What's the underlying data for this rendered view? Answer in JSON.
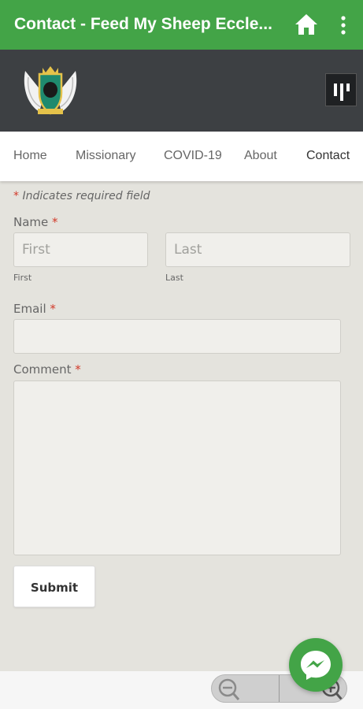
{
  "appbar": {
    "title": "Contact - Feed My Sheep Eccle...",
    "home_icon": "home-icon",
    "more_icon": "more-vert-icon",
    "color": "#43a447"
  },
  "header": {
    "logo_icon": "church-crest-logo",
    "menu_icon": "menu-toggle-icon",
    "background": "#3d4043"
  },
  "nav": {
    "items": [
      {
        "label": "Home"
      },
      {
        "label": "Missionary"
      },
      {
        "label": "COVID-19"
      },
      {
        "label": "About"
      },
      {
        "label": "Contact"
      }
    ]
  },
  "form": {
    "required_marker": "*",
    "required_note": "Indicates required field",
    "name": {
      "label": "Name",
      "first_placeholder": "First",
      "first_sublabel": "First",
      "last_placeholder": "Last",
      "last_sublabel": "Last"
    },
    "email": {
      "label": "Email",
      "value": ""
    },
    "comment": {
      "label": "Comment",
      "value": ""
    },
    "submit_label": "Submit"
  },
  "zoom": {
    "out_icon": "zoom-out-icon",
    "in_icon": "zoom-in-icon"
  },
  "chat": {
    "icon": "messenger-icon"
  }
}
